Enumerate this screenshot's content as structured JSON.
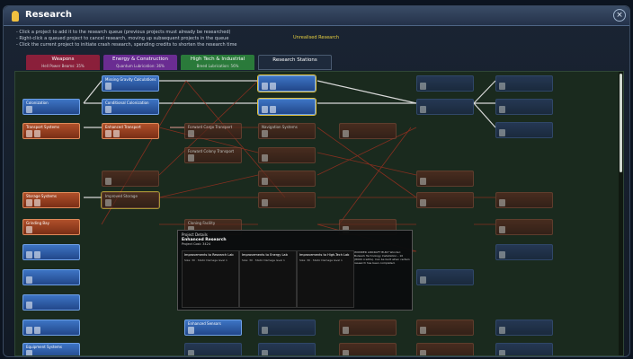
{
  "window": {
    "title": "Research"
  },
  "instructions": [
    "- Click a project to add it to the research queue (previous projects must already be researched)",
    "- Right-click a queued project to cancel research, moving up subsequent projects in the queue",
    "- Click the current project to initiate crash research, spending credits to shorten the research time"
  ],
  "unrealised_label": "Unrealised Research",
  "tabs": [
    {
      "label": "Weapons",
      "sub": "Hell Power Beams: 35%",
      "color": "#8a1f3a"
    },
    {
      "label": "Energy & Construction",
      "sub": "Quantum Lubrication: 36%",
      "color": "#6a2c92"
    },
    {
      "label": "High Tech & Industrial",
      "sub": "Breed Lubrication: 56%",
      "color": "#2a7a3a"
    },
    {
      "label": "Research Stations",
      "sub": "",
      "color": "#1e2a3c"
    }
  ],
  "nodes": [
    {
      "label": "Missing Gravity Calculations"
    },
    {
      "label": "Colonization"
    },
    {
      "label": "Conditional Colonization"
    },
    {
      "label": "Transport Systems"
    },
    {
      "label": "Enhanced Transport"
    },
    {
      "label": "Forward Cargo Transport"
    },
    {
      "label": "Navigation Systems"
    },
    {
      "label": "Forward Colony Transport"
    },
    {
      "label": "Storage Systems"
    },
    {
      "label": "Improved Storage"
    },
    {
      "label": "Grinding Bay"
    },
    {
      "label": "Cloning Facility"
    },
    {
      "label": "Enhanced Sensors"
    },
    {
      "label": "Equipment Systems"
    }
  ],
  "tooltip": {
    "project_label": "Project Details",
    "title": "Enhanced Research",
    "subtitle": "Effect: Improves research",
    "cost": "Project Cost: 3424",
    "name": "Enhanced Research",
    "boxes": [
      {
        "h": "Improvements to Research Lab",
        "l": "Size: 30 · Static Damage level 1"
      },
      {
        "h": "Improvements to Energy Lab",
        "l": "Size: 30 · Static Damage level 1"
      },
      {
        "h": "Improvements to High-Tech Lab",
        "l": "Size: 30 · Static Damage level 1"
      }
    ],
    "desc": "WONDER AIRCRAFT BUILT Wonder: Bulwark Technology Installation - 10 (8000 credits). Can be built when certain research has been completed."
  }
}
